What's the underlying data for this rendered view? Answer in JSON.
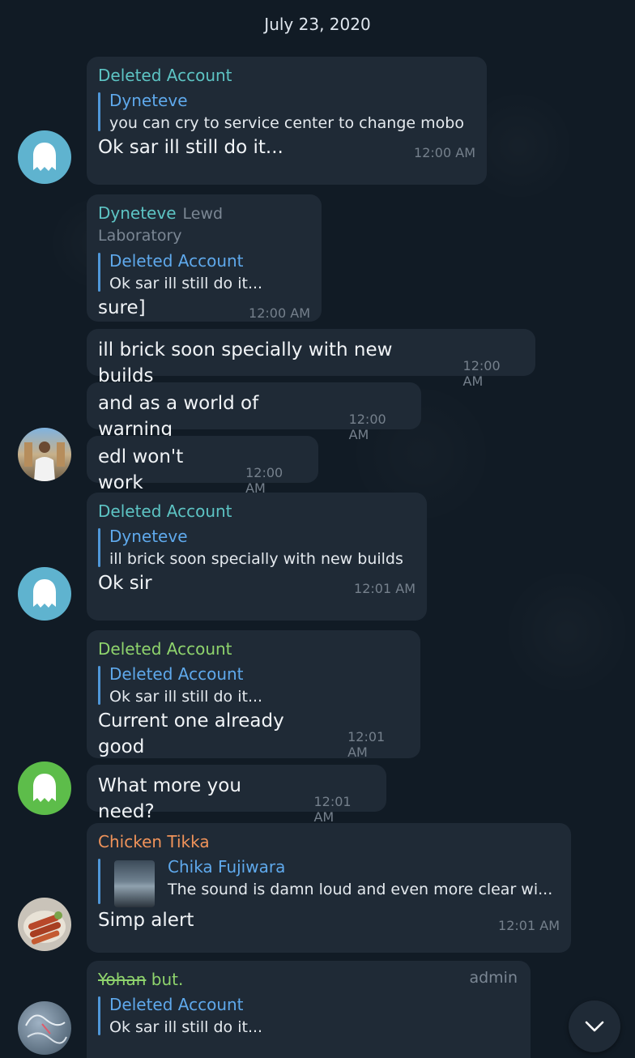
{
  "date_header": "July 23, 2020",
  "colors": {
    "background": "#111b25",
    "bubble": "#1f2a36",
    "teal_name": "#5dc4c4",
    "green_name": "#8fd46d",
    "orange_name": "#f0935a",
    "reply_name": "#5fa9ec",
    "time": "#75808c"
  },
  "messages": [
    {
      "sender": "Deleted Account",
      "reply_name": "Dyneteve",
      "reply_text": "you can cry to service center to change mobo",
      "text": "Ok sar ill still do it...",
      "time": "12:00 AM"
    },
    {
      "sender": "Dyneteve",
      "tag": "Lewd Laboratory",
      "reply_name": "Deleted Account",
      "reply_text": "Ok sar ill still do it...",
      "text": "sure]",
      "time": "12:00 AM"
    },
    {
      "text": "ill brick soon specially with new builds",
      "time": "12:00 AM"
    },
    {
      "text": "and as a world of warning",
      "time": "12:00 AM"
    },
    {
      "text": "edl won't work",
      "time": "12:00 AM"
    },
    {
      "sender": "Deleted Account",
      "reply_name": "Dyneteve",
      "reply_text": "ill brick soon specially with new builds",
      "text": "Ok sir",
      "time": "12:01 AM"
    },
    {
      "sender": "Deleted Account",
      "reply_name": "Deleted Account",
      "reply_text": "Ok sar ill still do it...",
      "text": "Current one already good",
      "time": "12:01 AM"
    },
    {
      "text": "What more you need?",
      "time": "12:01 AM"
    },
    {
      "sender": "Chicken Tikka",
      "reply_name": "Chika Fujiwara",
      "reply_text": "The sound is damn loud and even more clear wi...",
      "text": "Simp alert",
      "time": "12:01 AM"
    },
    {
      "sender_struck": "Yohan",
      "sender_rest": " but.",
      "badge": "admin",
      "reply_name": "Deleted Account",
      "reply_text": "Ok sar ill still do it..."
    }
  ]
}
